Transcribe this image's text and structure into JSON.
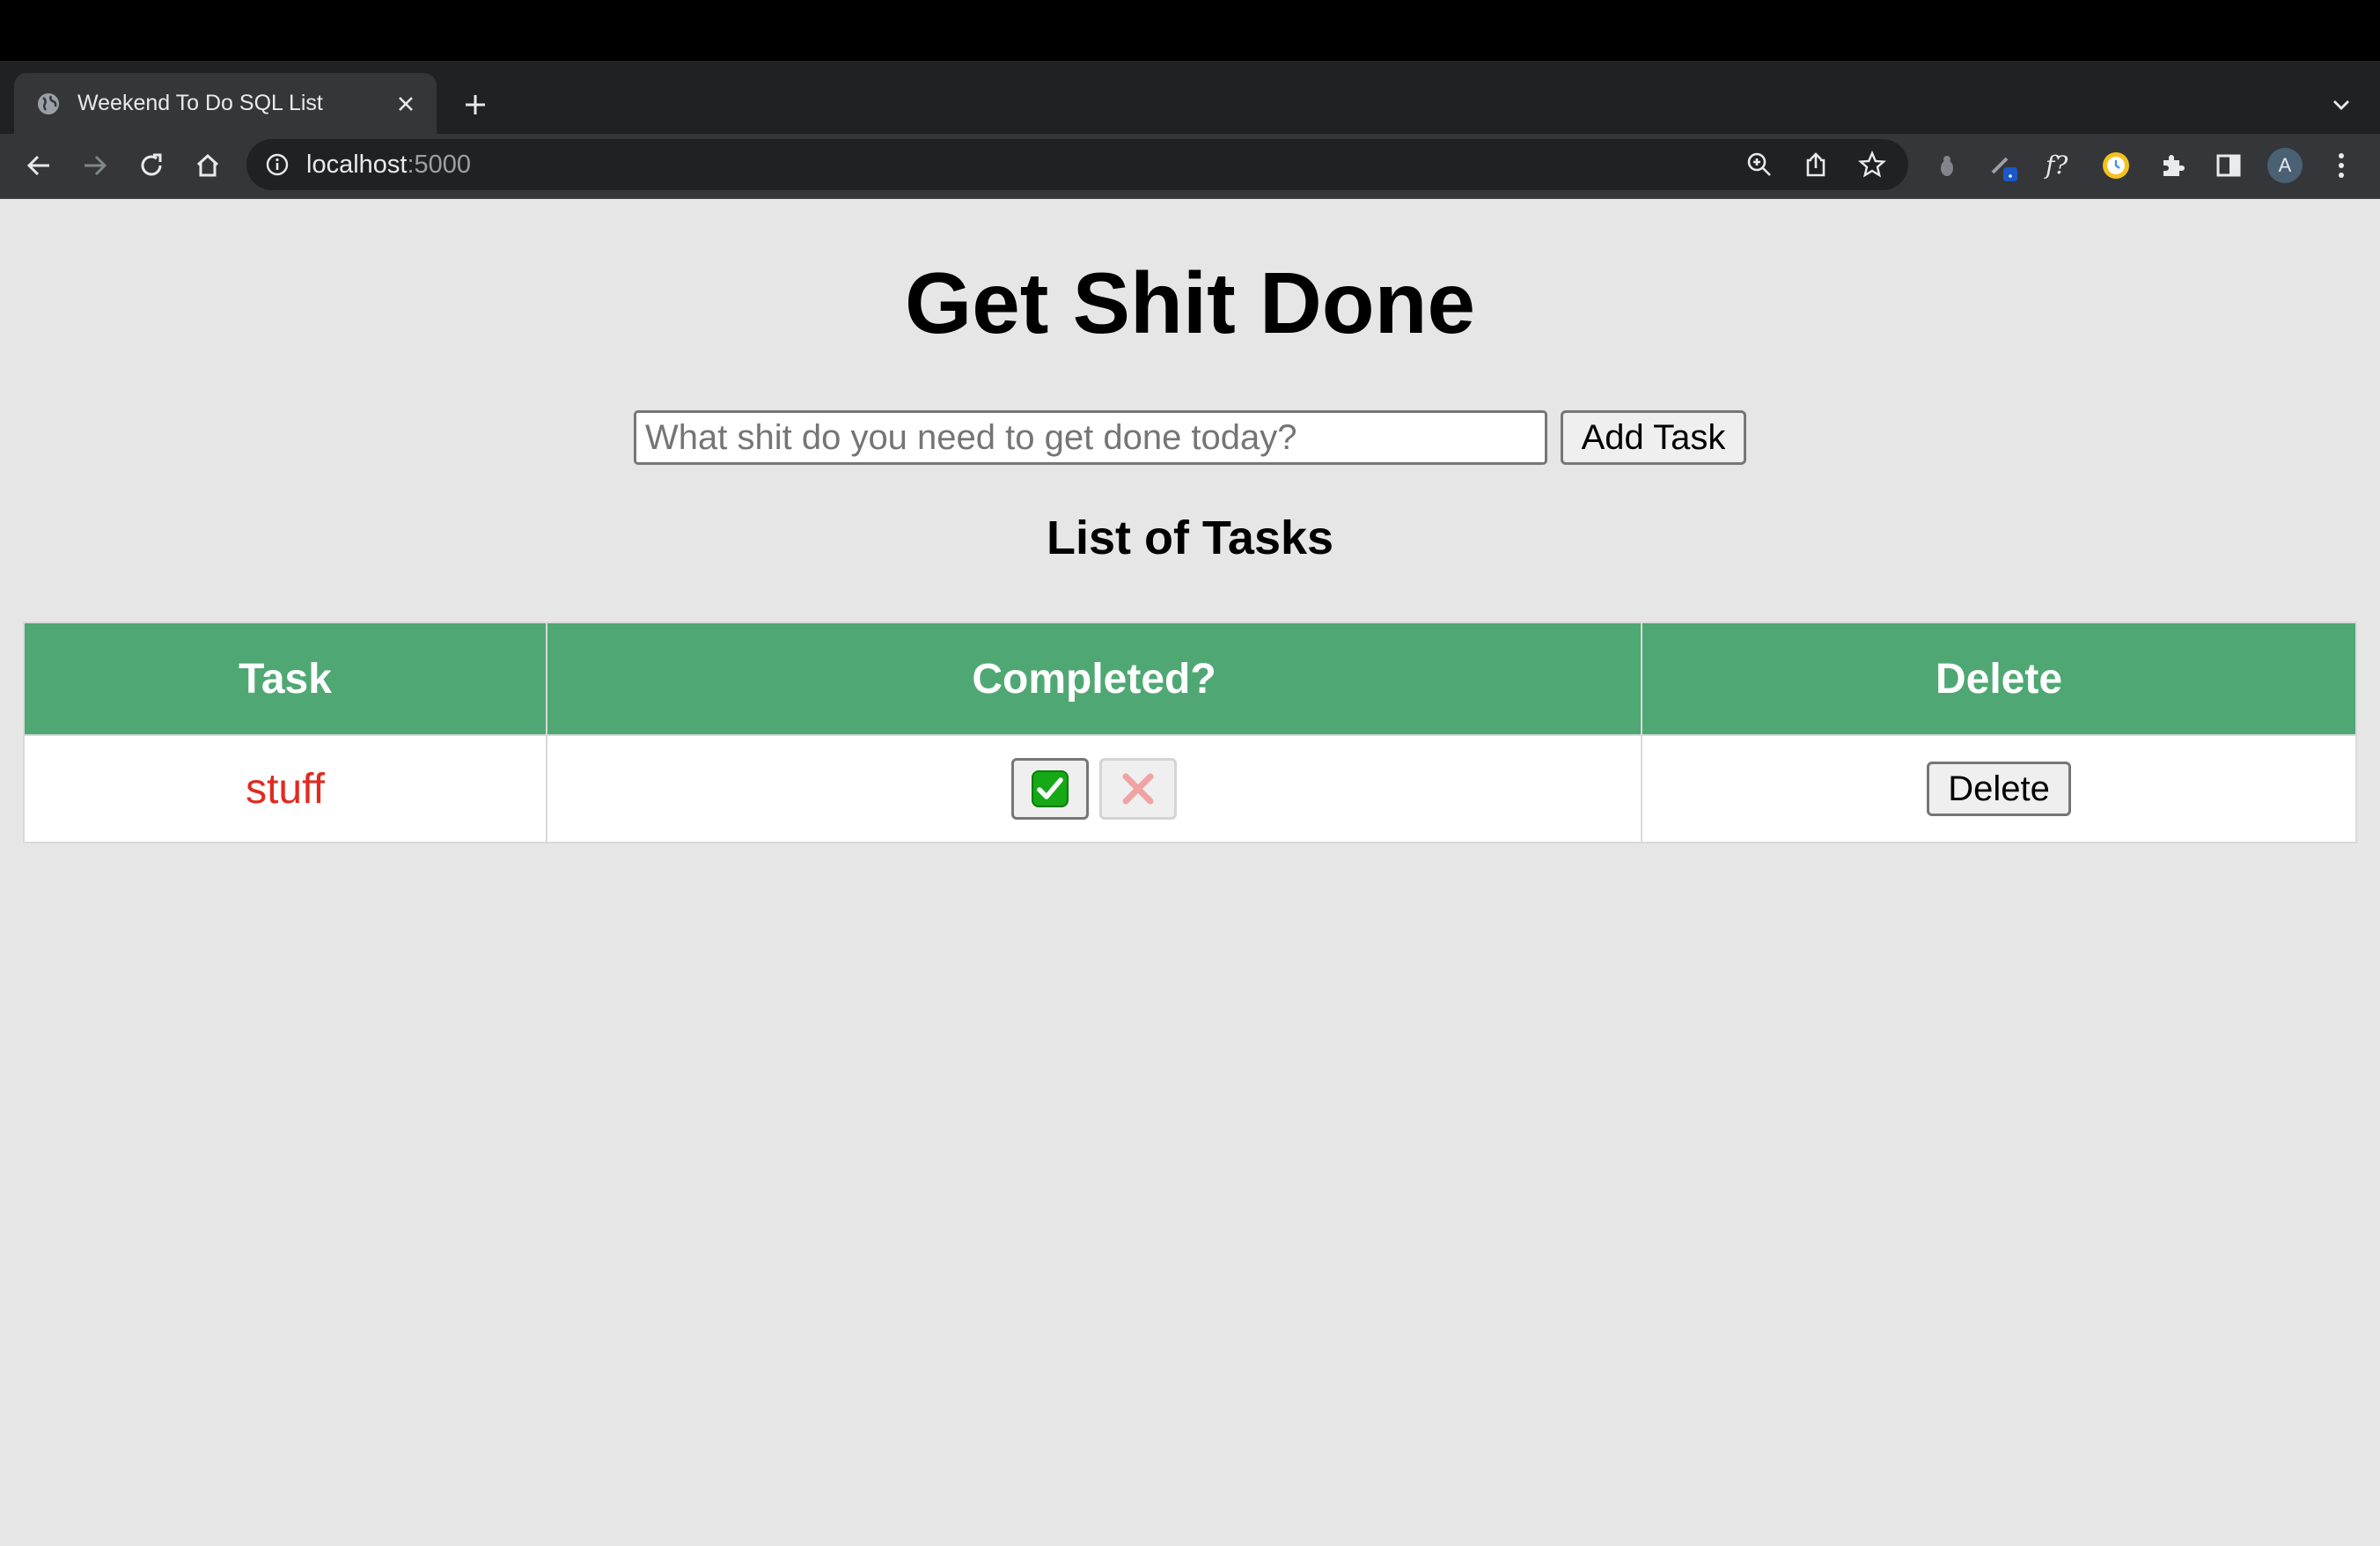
{
  "browser": {
    "tab": {
      "title": "Weekend To Do SQL List"
    },
    "address_bar": {
      "host": "localhost",
      "port": ":5000"
    },
    "avatar_initial": "A",
    "colors": {
      "tabstrip": "#202124",
      "toolbar": "#35363a"
    },
    "toolbar_icons": [
      "back-icon",
      "forward-icon",
      "reload-icon",
      "home-icon",
      "info-icon",
      "zoom-icon",
      "share-icon",
      "star-icon",
      "extensions-icon",
      "side-panel-icon",
      "menu-icon"
    ]
  },
  "page": {
    "title": "Get Shit Done",
    "input": {
      "placeholder": "What shit do you need to get done today?",
      "value": ""
    },
    "add_button": "Add Task",
    "list_heading": "List of Tasks",
    "table": {
      "headers": [
        "Task",
        "Completed?",
        "Delete"
      ],
      "rows": [
        {
          "task": "stuff",
          "completed_icon": "check-mark-button-icon",
          "undo_icon": "cross-mark-icon",
          "delete_label": "Delete"
        }
      ]
    },
    "colors": {
      "background": "#e6e6e6",
      "header": "#4fa874",
      "task_text": "#e02b20"
    }
  }
}
